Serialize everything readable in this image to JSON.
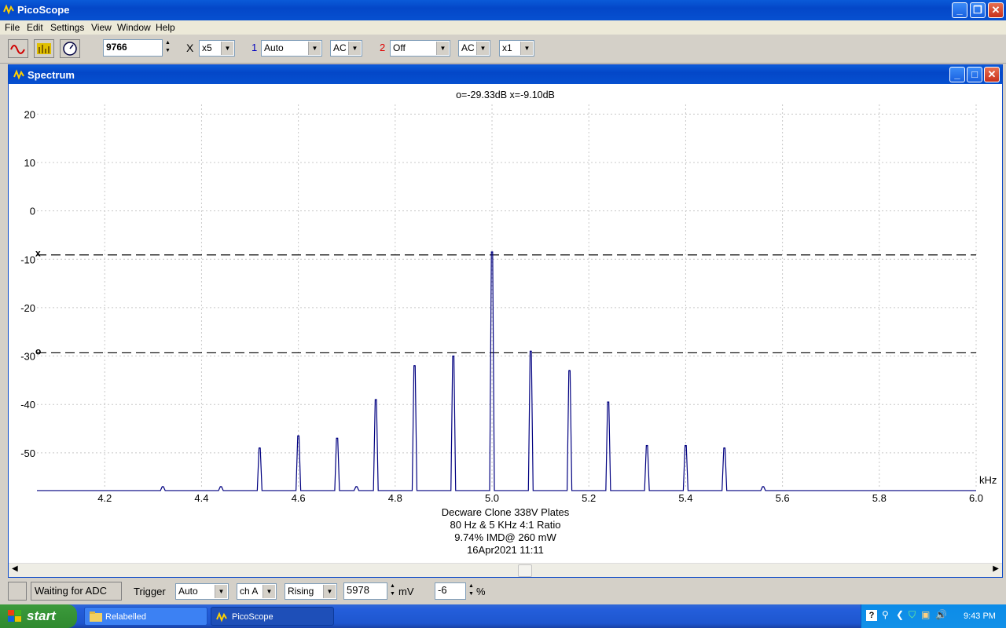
{
  "app": {
    "title": "PicoScope"
  },
  "menu": [
    "File",
    "Edit",
    "Settings",
    "View",
    "Window",
    "Help"
  ],
  "toolbar": {
    "samples": "9766",
    "zoom_prefix": "X",
    "zoom": "x5",
    "ch1_number": "1",
    "ch1_range": "Auto",
    "ch1_coupling": "AC",
    "ch2_number": "2",
    "ch2_range": "Off",
    "ch2_coupling": "AC",
    "ch2_mult": "x1"
  },
  "spectrum_window": {
    "title": "Spectrum"
  },
  "readout": "o=-29.33dB  x=-9.10dB",
  "annotation": [
    "Decware Clone 338V Plates",
    "80 Hz & 5 KHz 4:1 Ratio",
    "9.74% IMD@ 260 mW",
    "16Apr2021  11:11"
  ],
  "marker_labels": {
    "x": "x",
    "o": "o"
  },
  "chart_data": {
    "type": "line",
    "xlabel": "kHz",
    "ylabel": "",
    "xlim": [
      4.06,
      6.0
    ],
    "ylim": [
      -57,
      22
    ],
    "x_ticks": [
      4.2,
      4.4,
      4.6,
      4.8,
      5.0,
      5.2,
      5.4,
      5.6,
      5.8,
      6.0
    ],
    "x_tick_labels": [
      "4.2",
      "4.4",
      "4.6",
      "4.8",
      "5.0",
      "5.2",
      "5.4",
      "5.6",
      "5.8",
      "6.0"
    ],
    "y_ticks": [
      20,
      10,
      0,
      -10,
      -20,
      -30,
      -40,
      -50
    ],
    "y_tick_labels": [
      "20",
      "10",
      "0",
      "-10",
      "-20",
      "-30",
      "-40",
      "-50"
    ],
    "baseline_db": -57.8,
    "peaks": [
      {
        "x": 4.32,
        "y": -57.0
      },
      {
        "x": 4.44,
        "y": -57.0
      },
      {
        "x": 4.52,
        "y": -49.0
      },
      {
        "x": 4.6,
        "y": -46.5
      },
      {
        "x": 4.68,
        "y": -47.0
      },
      {
        "x": 4.72,
        "y": -57.0
      },
      {
        "x": 4.76,
        "y": -39.0
      },
      {
        "x": 4.84,
        "y": -32.0
      },
      {
        "x": 4.92,
        "y": -30.0
      },
      {
        "x": 5.0,
        "y": -8.5
      },
      {
        "x": 5.08,
        "y": -29.0
      },
      {
        "x": 5.16,
        "y": -33.0
      },
      {
        "x": 5.24,
        "y": -39.5
      },
      {
        "x": 5.32,
        "y": -48.5
      },
      {
        "x": 5.4,
        "y": -48.5
      },
      {
        "x": 5.48,
        "y": -49.0
      },
      {
        "x": 5.56,
        "y": -57.0
      }
    ],
    "markers": [
      {
        "name": "x",
        "value": -9.1
      },
      {
        "name": "o",
        "value": -29.33
      }
    ],
    "grid": true,
    "line_color": "#000080"
  },
  "status": {
    "state": "Waiting for ADC",
    "trigger_label": "Trigger",
    "trigger_mode": "Auto",
    "trigger_channel": "ch A",
    "trigger_edge": "Rising",
    "trigger_level": "5978",
    "trigger_unit": "mV",
    "pretrigger": "-6",
    "pretrigger_unit": "%"
  },
  "taskbar": {
    "start": "start",
    "tasks": [
      "Relabelled",
      "PicoScope"
    ],
    "clock": "9:43 PM"
  },
  "colors": {
    "ch1": "#0000c0",
    "ch2": "#e00000",
    "xp_blue": "#0a5ad8",
    "trace": "#000080"
  }
}
